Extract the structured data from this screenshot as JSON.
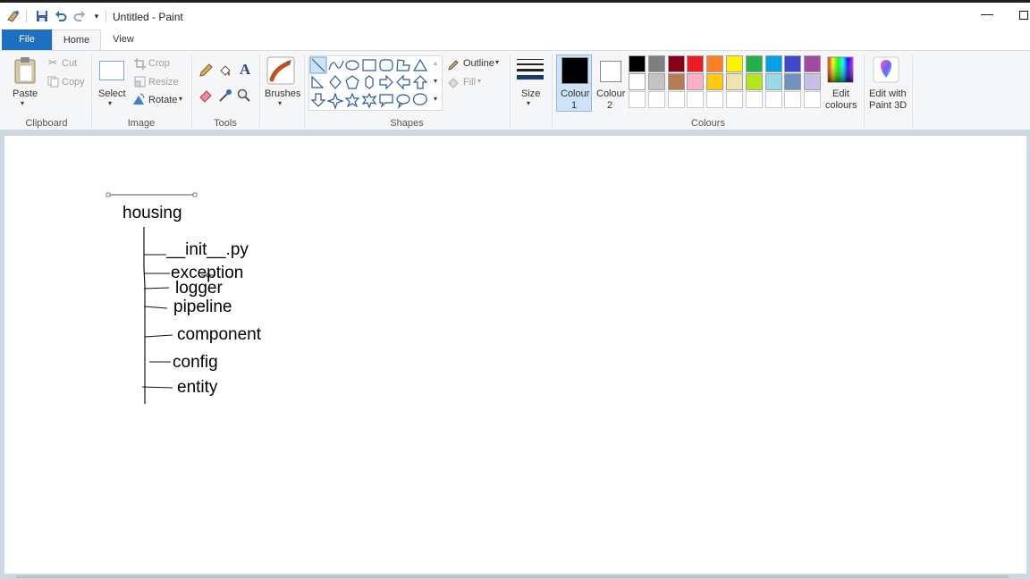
{
  "window": {
    "title": "Untitled - Paint"
  },
  "tabs": {
    "file": "File",
    "home": "Home",
    "view": "View"
  },
  "clipboard": {
    "paste": "Paste",
    "cut": "Cut",
    "copy": "Copy",
    "label": "Clipboard"
  },
  "image": {
    "select": "Select",
    "crop": "Crop",
    "resize": "Resize",
    "rotate": "Rotate",
    "label": "Image"
  },
  "tools": {
    "label": "Tools",
    "text_glyph": "A"
  },
  "brushes": {
    "label": "Brushes"
  },
  "shapes": {
    "label": "Shapes",
    "outline": "Outline",
    "fill": "Fill"
  },
  "size": {
    "label": "Size"
  },
  "colours": {
    "colour1": "Colour",
    "colour1_num": "1",
    "colour2": "Colour",
    "colour2_num": "2",
    "edit_colours_line1": "Edit",
    "edit_colours_line2": "colours",
    "paint3d_line1": "Edit with",
    "paint3d_line2": "Paint 3D",
    "label": "Colours",
    "colour1_value": "#000000",
    "colour2_value": "#ffffff",
    "palette_row1": [
      "#000000",
      "#7f7f7f",
      "#880015",
      "#ed1c24",
      "#ff7f27",
      "#fff200",
      "#22b14c",
      "#00a2e8",
      "#3f48cc",
      "#a349a4"
    ],
    "palette_row2": [
      "#ffffff",
      "#c3c3c3",
      "#b97a57",
      "#ffaec9",
      "#ffc90e",
      "#efe4b0",
      "#b5e61d",
      "#99d9ea",
      "#7092be",
      "#c8bfe7"
    ]
  },
  "drawing": {
    "root": "housing",
    "items": [
      "__init__.py",
      "exception",
      "logger",
      "pipeline",
      "component",
      "config",
      "entity"
    ]
  }
}
